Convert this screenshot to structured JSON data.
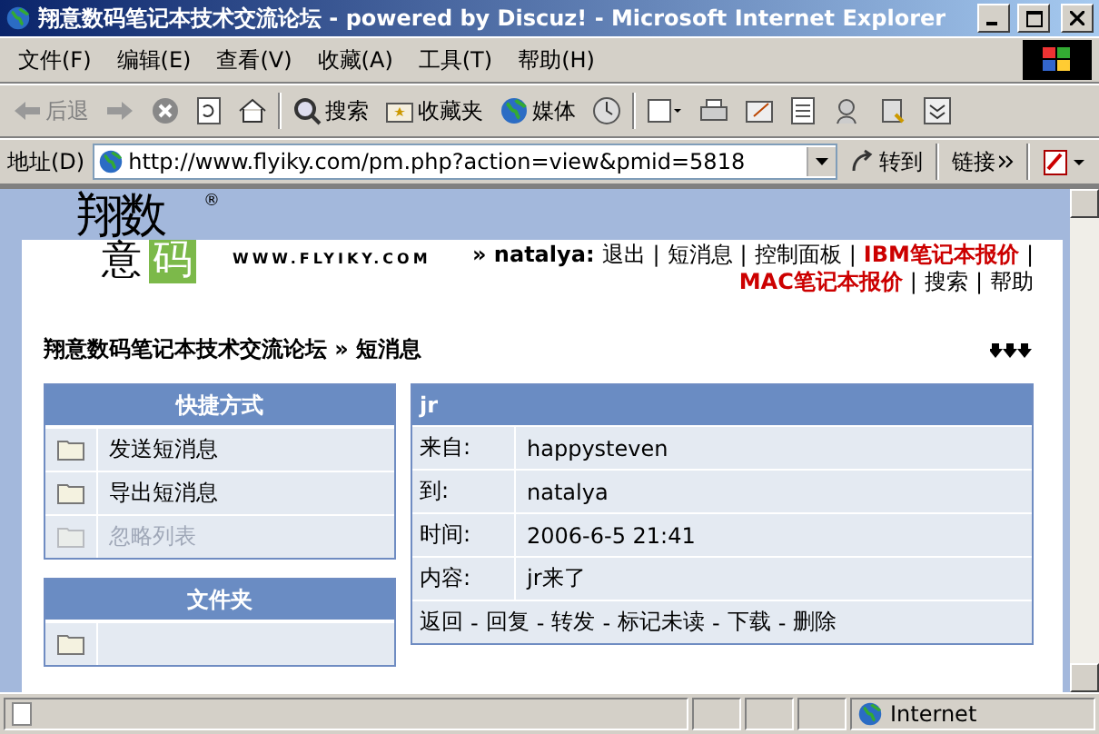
{
  "window": {
    "title": "翔意数码笔记本技术交流论坛 - powered by Discuz! - Microsoft Internet Explorer"
  },
  "menu": [
    "文件(F)",
    "编辑(E)",
    "查看(V)",
    "收藏(A)",
    "工具(T)",
    "帮助(H)"
  ],
  "toolbar": {
    "back": "后退",
    "search": "搜索",
    "favorites": "收藏夹",
    "media": "媒体"
  },
  "address": {
    "label": "地址(D)",
    "value": "http://www.flyiky.com/pm.php?action=view&pmid=5818",
    "go": "转到",
    "links": "链接"
  },
  "header": {
    "logo_top": "翔数",
    "logo_mark": "®",
    "logo_left": "意",
    "logo_right": "码",
    "url": "WWW.FLYIKY.COM",
    "user": "» natalya:",
    "separator": "|",
    "links": [
      {
        "text": "退出",
        "kind": "normal"
      },
      {
        "text": "短消息",
        "kind": "normal"
      },
      {
        "text": "控制面板",
        "kind": "normal"
      },
      {
        "text": "IBM笔记本报价",
        "kind": "red"
      },
      {
        "text": "MAC笔记本报价",
        "kind": "red"
      },
      {
        "text": "搜索",
        "kind": "normal"
      },
      {
        "text": "帮助",
        "kind": "normal"
      }
    ]
  },
  "breadcrumb": "翔意数码笔记本技术交流论坛 » 短消息",
  "panels": [
    {
      "title": "快捷方式",
      "items": [
        {
          "label": "发送短消息",
          "disabled": false
        },
        {
          "label": "导出短消息",
          "disabled": false
        },
        {
          "label": "忽略列表",
          "disabled": true
        }
      ]
    },
    {
      "title": "文件夹"
    }
  ],
  "message": {
    "title": "jr",
    "fields": [
      {
        "label": "来自:",
        "value": "happysteven"
      },
      {
        "label": "到:",
        "value": "natalya"
      },
      {
        "label": "时间:",
        "value": "2006-6-5 21:41"
      },
      {
        "label": "内容:",
        "value": "jr来了"
      }
    ],
    "separator": "-",
    "actions": [
      "返回",
      "回复",
      "转发",
      "标记未读",
      "下载",
      "删除"
    ]
  },
  "status": {
    "zone": "Internet"
  }
}
